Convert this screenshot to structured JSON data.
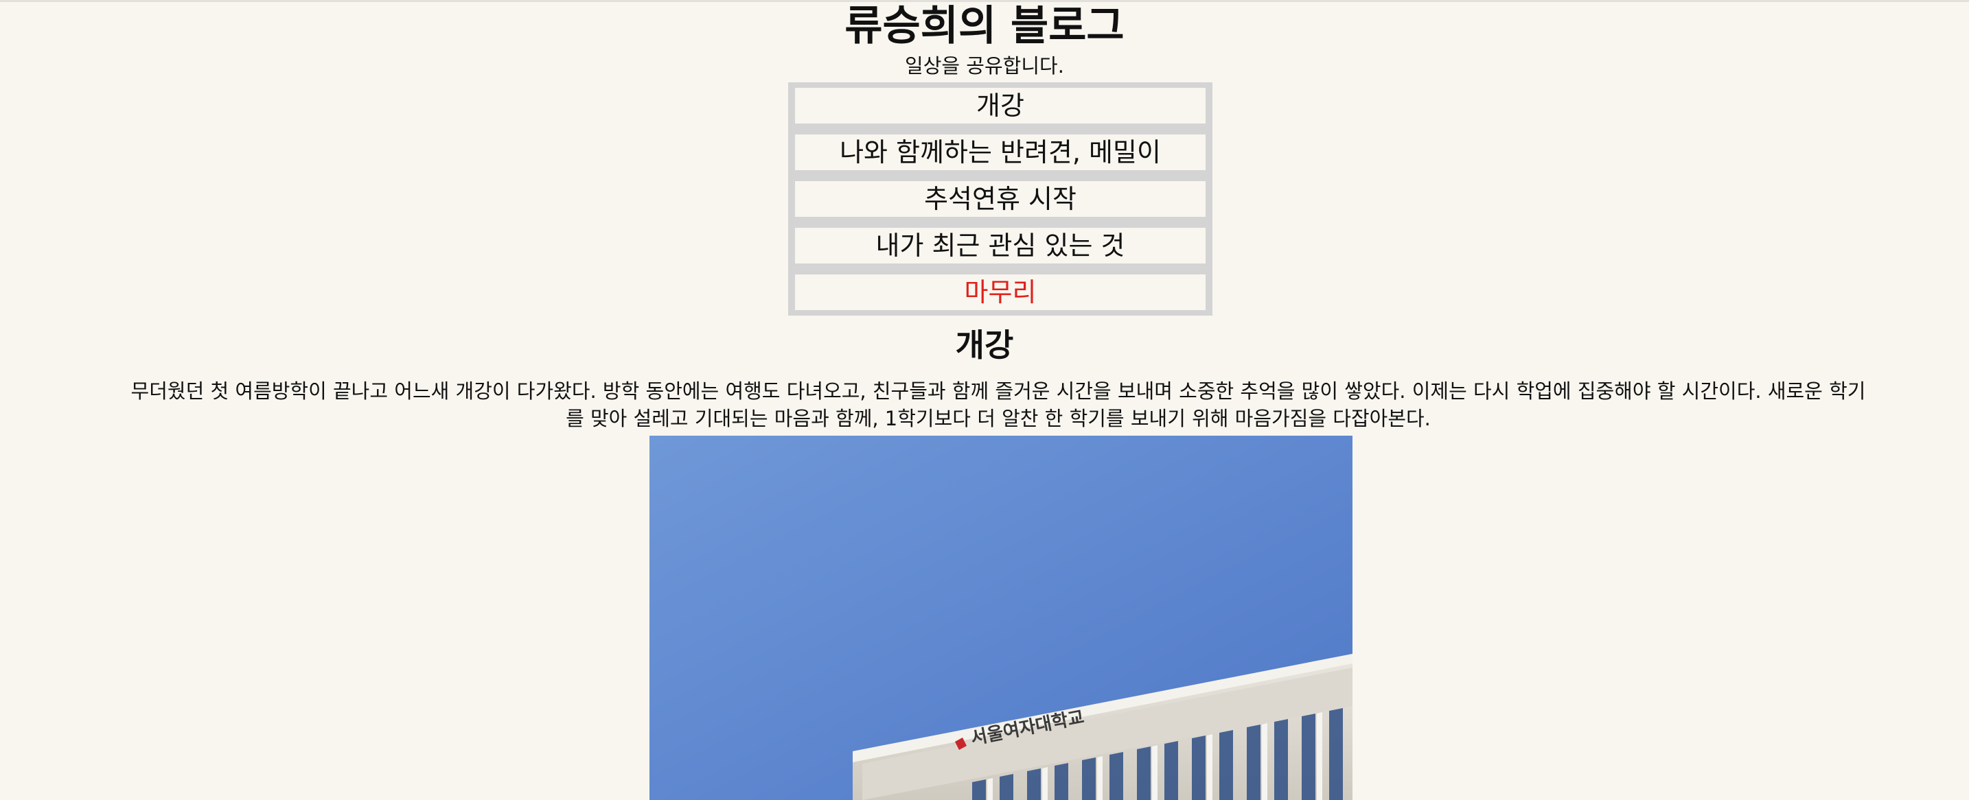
{
  "header": {
    "title": "류승희의 블로그",
    "subtitle": "일상을 공유합니다."
  },
  "nav": {
    "items": [
      {
        "label": "개강",
        "active": false
      },
      {
        "label": "나와 함께하는 반려견, 메밀이",
        "active": false
      },
      {
        "label": "추석연휴 시작",
        "active": false
      },
      {
        "label": "내가 최근 관심 있는 것",
        "active": false
      },
      {
        "label": "마무리",
        "active": true
      }
    ],
    "active_color": "#e0211c",
    "background_color": "#d4d4d4"
  },
  "section": {
    "title": "개강",
    "body": "무더웠던 첫 여름방학이 끝나고 어느새 개강이 다가왔다. 방학 동안에는 여행도 다녀오고, 친구들과 함께 즐거운 시간을 보내며 소중한 추억을 많이 쌓았다. 이제는 다시 학업에 집중해야 할 시간이다. 새로운 학기를 맞아 설레고 기대되는 마음과 함께, 1학기보다 더 알찬 한 학기를 보내기 위해 마음가짐을 다잡아본다.",
    "image": {
      "description_icon": "campus-building-photo",
      "sign_text": "서울여자대학교"
    }
  },
  "colors": {
    "page_background": "#f8f6ef",
    "text": "#111111",
    "sky": "#5b86d1"
  }
}
